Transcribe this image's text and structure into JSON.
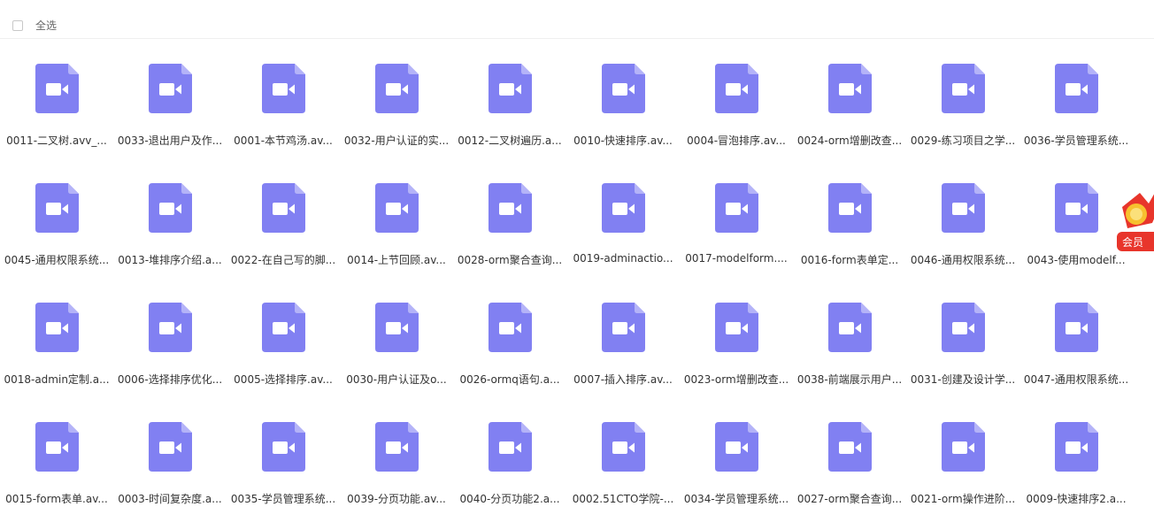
{
  "toolbar": {
    "select_all_label": "全选"
  },
  "colors": {
    "file_icon": "#8180f2",
    "file_icon_fold": "#b4b3f8",
    "text": "#333333"
  },
  "files": [
    "0011-二叉树.avv_...",
    "0033-退出用户及作...",
    "0001-本节鸡汤.av...",
    "0032-用户认证的实...",
    "0012-二叉树遍历.a...",
    "0010-快速排序.av...",
    "0004-冒泡排序.av...",
    "0024-orm增删改查...",
    "0029-练习项目之学...",
    "0036-学员管理系统...",
    "0045-通用权限系统...",
    "0013-堆排序介绍.a...",
    "0022-在自己写的脚...",
    "0014-上节回顾.av...",
    "0028-orm聚合查询...",
    "0019-adminactio...",
    "0017-modelform....",
    "0016-form表单定...",
    "0046-通用权限系统...",
    "0043-使用modelf...",
    "0018-admin定制.a...",
    "0006-选择排序优化...",
    "0005-选择排序.av...",
    "0030-用户认证及o...",
    "0026-ormq语句.a...",
    "0007-插入排序.av...",
    "0023-orm增删改查...",
    "0038-前端展示用户...",
    "0031-创建及设计学...",
    "0047-通用权限系统...",
    "0015-form表单.av...",
    "0003-时间复杂度.a...",
    "0035-学员管理系统...",
    "0039-分页功能.av...",
    "0040-分页功能2.a...",
    "0002.51CTO学院-...",
    "0034-学员管理系统...",
    "0027-orm聚合查询...",
    "0021-orm操作进阶...",
    "0009-快速排序2.a..."
  ],
  "promo": {
    "label": "会员"
  }
}
